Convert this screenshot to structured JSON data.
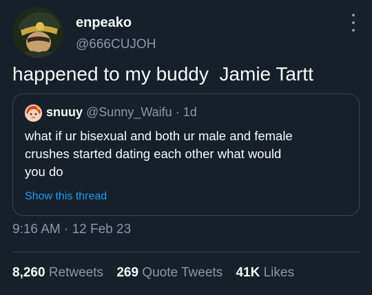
{
  "author": {
    "display_name": "enpeako",
    "handle": "@666CUJOH"
  },
  "tweet": {
    "text": "happened to my buddy  Jamie Tartt",
    "timestamp": "9:16 AM · 12 Feb 23"
  },
  "quote": {
    "display_name": "snuuy",
    "handle": "@Sunny_Waifu",
    "time": "· 1d",
    "lines": [
      "what if ur bisexual and both ur male and female",
      "crushes started dating each other what would",
      "you do"
    ],
    "show_thread": "Show this thread"
  },
  "stats": {
    "retweets": {
      "count": "8,260",
      "label": "Retweets"
    },
    "quote_tweets": {
      "count": "269",
      "label": "Quote Tweets"
    },
    "likes": {
      "count": "41K",
      "label": "Likes"
    }
  },
  "colors": {
    "background": "#15202b",
    "text": "#f7f9f9",
    "secondary": "#8b98a5",
    "link": "#1d9bf0",
    "border": "#38444d"
  }
}
